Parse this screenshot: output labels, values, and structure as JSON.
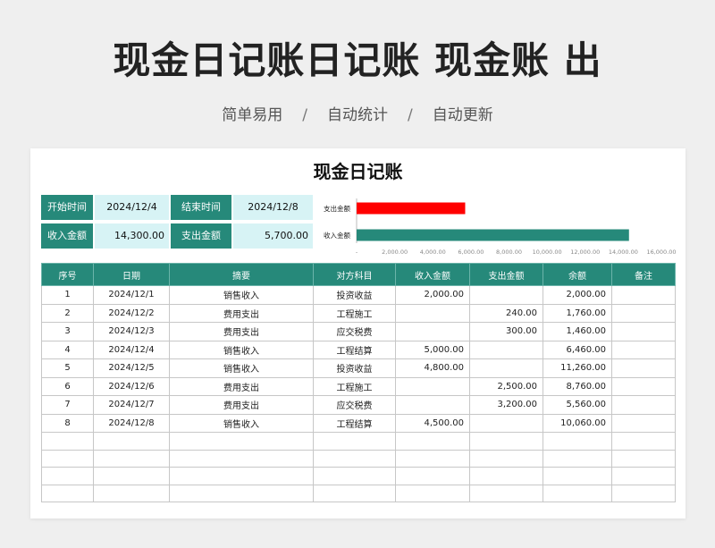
{
  "banner": {
    "title": "现金日记账日记账 现金账 出",
    "tags": [
      "简单易用",
      "自动统计",
      "自动更新"
    ],
    "separator": "/"
  },
  "sheet": {
    "title": "现金日记账"
  },
  "summary": {
    "start_label": "开始时间",
    "start_value": "2024/12/4",
    "end_label": "结束时间",
    "end_value": "2024/12/8",
    "income_label": "收入金额",
    "income_value": "14,300.00",
    "expense_label": "支出金额",
    "expense_value": "5,700.00"
  },
  "chart_data": {
    "type": "bar",
    "orientation": "horizontal",
    "categories": [
      "支出金额",
      "收入金额"
    ],
    "values": [
      5700,
      14300
    ],
    "colors": [
      "#ff0000",
      "#26897a"
    ],
    "xlim": [
      0,
      16000
    ],
    "xticks": [
      "-",
      "2,000.00",
      "4,000.00",
      "6,000.00",
      "8,000.00",
      "10,000.00",
      "12,000.00",
      "14,000.00",
      "16,000.00"
    ],
    "grid": false,
    "legend": "none"
  },
  "ledger": {
    "headers": [
      "序号",
      "日期",
      "摘要",
      "对方科目",
      "收入金额",
      "支出金额",
      "余额",
      "备注"
    ],
    "rows": [
      {
        "no": "1",
        "date": "2024/12/1",
        "summary": "销售收入",
        "account": "投资收益",
        "income": "2,000.00",
        "expense": "",
        "balance": "2,000.00",
        "note": ""
      },
      {
        "no": "2",
        "date": "2024/12/2",
        "summary": "费用支出",
        "account": "工程施工",
        "income": "",
        "expense": "240.00",
        "balance": "1,760.00",
        "note": ""
      },
      {
        "no": "3",
        "date": "2024/12/3",
        "summary": "费用支出",
        "account": "应交税费",
        "income": "",
        "expense": "300.00",
        "balance": "1,460.00",
        "note": ""
      },
      {
        "no": "4",
        "date": "2024/12/4",
        "summary": "销售收入",
        "account": "工程结算",
        "income": "5,000.00",
        "expense": "",
        "balance": "6,460.00",
        "note": ""
      },
      {
        "no": "5",
        "date": "2024/12/5",
        "summary": "销售收入",
        "account": "投资收益",
        "income": "4,800.00",
        "expense": "",
        "balance": "11,260.00",
        "note": ""
      },
      {
        "no": "6",
        "date": "2024/12/6",
        "summary": "费用支出",
        "account": "工程施工",
        "income": "",
        "expense": "2,500.00",
        "balance": "8,760.00",
        "note": ""
      },
      {
        "no": "7",
        "date": "2024/12/7",
        "summary": "费用支出",
        "account": "应交税费",
        "income": "",
        "expense": "3,200.00",
        "balance": "5,560.00",
        "note": ""
      },
      {
        "no": "8",
        "date": "2024/12/8",
        "summary": "销售收入",
        "account": "工程结算",
        "income": "4,500.00",
        "expense": "",
        "balance": "10,060.00",
        "note": ""
      }
    ],
    "blank_rows": 4
  }
}
